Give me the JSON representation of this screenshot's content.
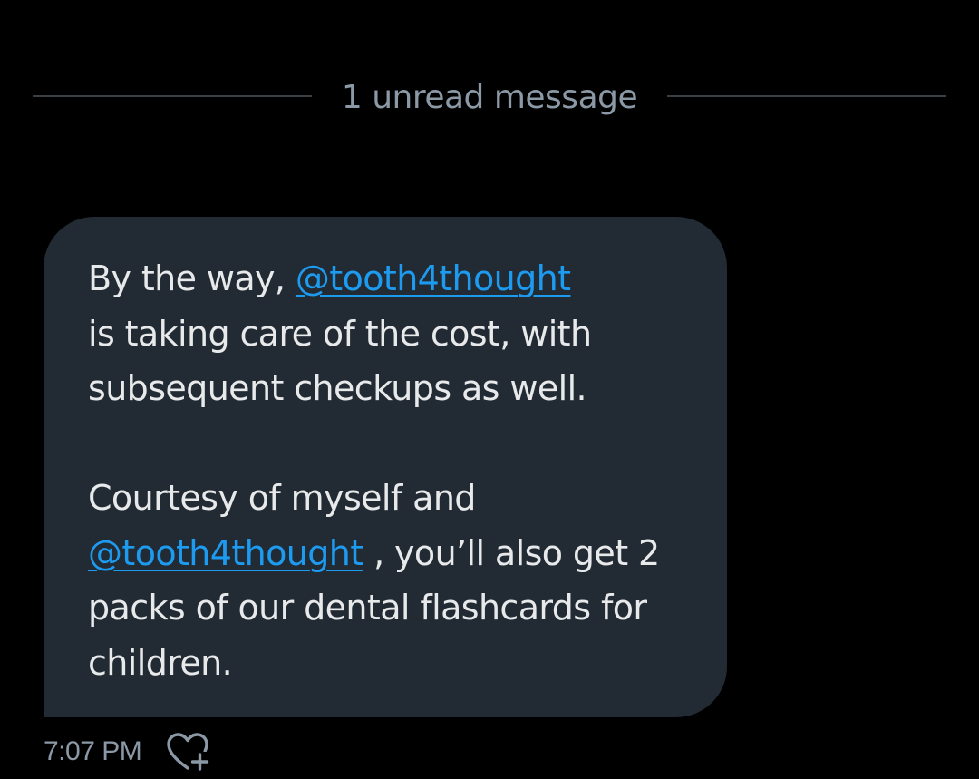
{
  "divider": {
    "label": "1 unread message"
  },
  "message": {
    "paragraph1": {
      "prefix": "By the way, ",
      "mention": "@tooth4thought",
      "suffix": "is taking care of the cost, with subsequent checkups as well."
    },
    "paragraph2": {
      "prefix": "Courtesy of myself and",
      "mention": "@tooth4thought",
      "suffix": " , you’ll also get 2 packs of our dental flashcards for children."
    },
    "timestamp": "7:07 PM",
    "reaction_icon": "heart-plus-icon"
  },
  "colors": {
    "background": "#000000",
    "bubble": "#222b33",
    "text": "#e7e9ea",
    "muted": "#8b98a5",
    "link": "#1d9bf0"
  }
}
